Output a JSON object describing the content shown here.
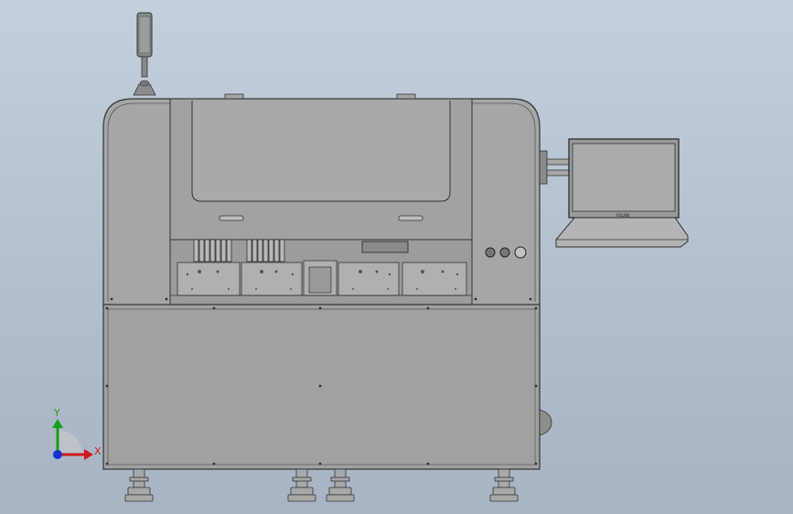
{
  "view": {
    "background_top": "#c5cfdc",
    "background_bottom": "#a8b4c4"
  },
  "machine": {
    "body_color": "#a4a4a4",
    "frame_color": "#9a9a9a",
    "edge_color": "#3a3a3a",
    "lower_cabinet_color": "#9f9f9f"
  },
  "monitor": {
    "brand": "FOLINK"
  },
  "triad": {
    "x_label": "X",
    "y_label": "Y",
    "x_color": "#d01818",
    "y_color": "#18a018",
    "z_color": "#1830d0"
  },
  "icons": [
    "signal-tower-icon",
    "monitor-icon",
    "keyboard-icon",
    "coordinate-triad-icon"
  ]
}
